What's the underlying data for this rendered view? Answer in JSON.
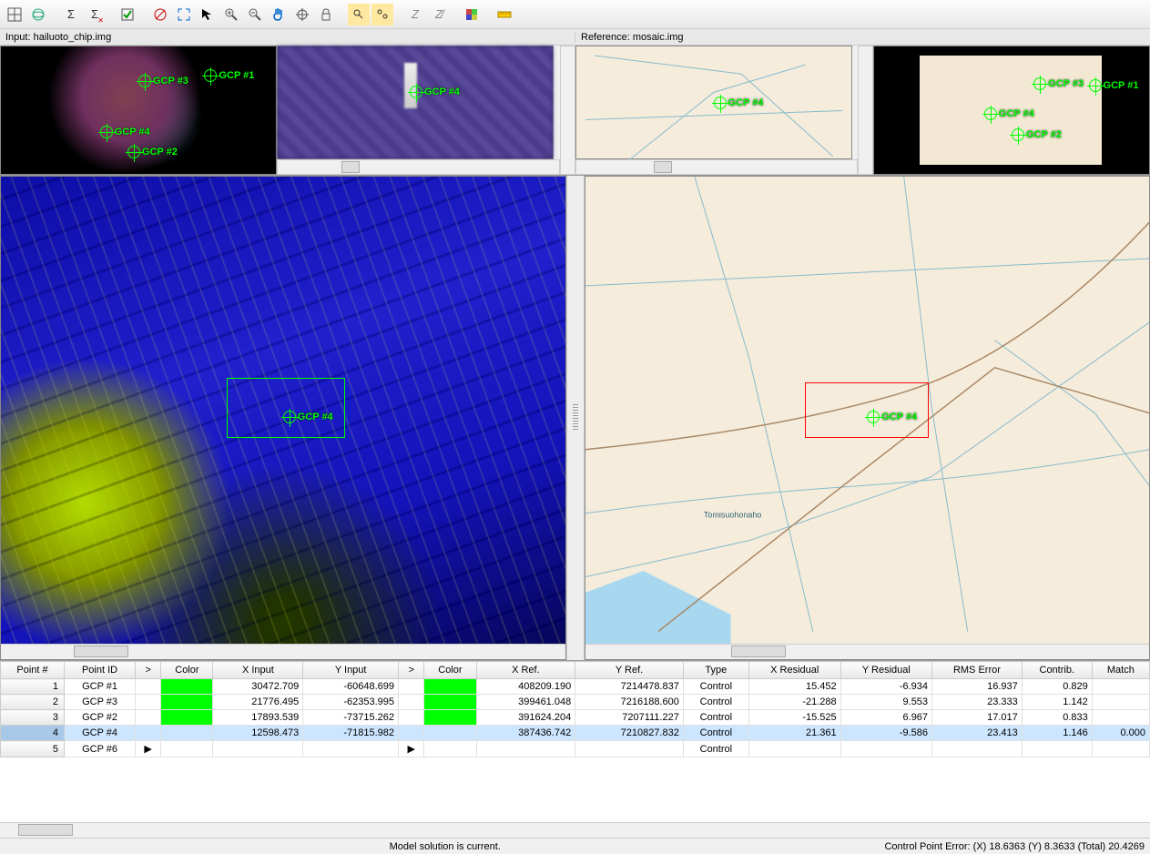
{
  "toolbar_icons": [
    "grid",
    "globe",
    "sigma",
    "sigma-err",
    "check",
    "no-auto",
    "fit",
    "arrow",
    "zoom-in",
    "zoom-out",
    "pan",
    "target",
    "lock",
    "find",
    "find-all",
    "z1",
    "z2",
    "swatch",
    "ruler"
  ],
  "labels": {
    "input": "Input: hailuoto_chip.img",
    "reference": "Reference: mosaic.img"
  },
  "gcp_markers": {
    "input_overview": [
      {
        "label": "GCP #1",
        "x": 74,
        "y": 18
      },
      {
        "label": "GCP #3",
        "x": 50,
        "y": 22
      },
      {
        "label": "GCP #4",
        "x": 36,
        "y": 62
      },
      {
        "label": "GCP #2",
        "x": 46,
        "y": 78
      }
    ],
    "input_zoom": [
      {
        "label": "GCP #4",
        "x": 48,
        "y": 35
      }
    ],
    "ref_overview": [
      {
        "label": "GCP #4",
        "x": 50,
        "y": 45
      }
    ],
    "ref_thumb": [
      {
        "label": "GCP #1",
        "x": 78,
        "y": 26
      },
      {
        "label": "GCP #3",
        "x": 58,
        "y": 24
      },
      {
        "label": "GCP #4",
        "x": 40,
        "y": 48
      },
      {
        "label": "GCP #2",
        "x": 50,
        "y": 64
      }
    ],
    "main_left": [
      {
        "label": "GCP #4",
        "x": 50,
        "y": 50
      }
    ],
    "main_right": [
      {
        "label": "GCP #4",
        "x": 50,
        "y": 50
      }
    ]
  },
  "table": {
    "headers": [
      "Point #",
      "Point ID",
      ">",
      "Color",
      "X Input",
      "Y Input",
      ">",
      "Color",
      "X Ref.",
      "Y Ref.",
      "Type",
      "X Residual",
      "Y Residual",
      "RMS Error",
      "Contrib.",
      "Match"
    ],
    "rows": [
      {
        "num": "1",
        "id": "GCP #1",
        "xin": "30472.709",
        "yin": "-60648.699",
        "xref": "408209.190",
        "yref": "7214478.837",
        "type": "Control",
        "xres": "15.452",
        "yres": "-6.934",
        "rms": "16.937",
        "contrib": "0.829",
        "match": ""
      },
      {
        "num": "2",
        "id": "GCP #3",
        "xin": "21776.495",
        "yin": "-62353.995",
        "xref": "399461.048",
        "yref": "7216188.600",
        "type": "Control",
        "xres": "-21.288",
        "yres": "9.553",
        "rms": "23.333",
        "contrib": "1.142",
        "match": ""
      },
      {
        "num": "3",
        "id": "GCP #2",
        "xin": "17893.539",
        "yin": "-73715.262",
        "xref": "391624.204",
        "yref": "7207111.227",
        "type": "Control",
        "xres": "-15.525",
        "yres": "6.967",
        "rms": "17.017",
        "contrib": "0.833",
        "match": ""
      },
      {
        "num": "4",
        "id": "GCP #4",
        "xin": "12598.473",
        "yin": "-71815.982",
        "xref": "387436.742",
        "yref": "7210827.832",
        "type": "Control",
        "xres": "21.361",
        "yres": "-9.586",
        "rms": "23.413",
        "contrib": "1.146",
        "match": "0.000",
        "selected": true
      },
      {
        "num": "5",
        "id": "GCP #6",
        "xin": "",
        "yin": "",
        "xref": "",
        "yref": "",
        "type": "Control",
        "xres": "",
        "yres": "",
        "rms": "",
        "contrib": "",
        "match": "",
        "arrows": true,
        "nocolor": true
      }
    ]
  },
  "status": {
    "center": "Model solution is current.",
    "right": "Control Point Error: (X) 18.6363   (Y) 8.3633   (Total) 20.4269"
  }
}
